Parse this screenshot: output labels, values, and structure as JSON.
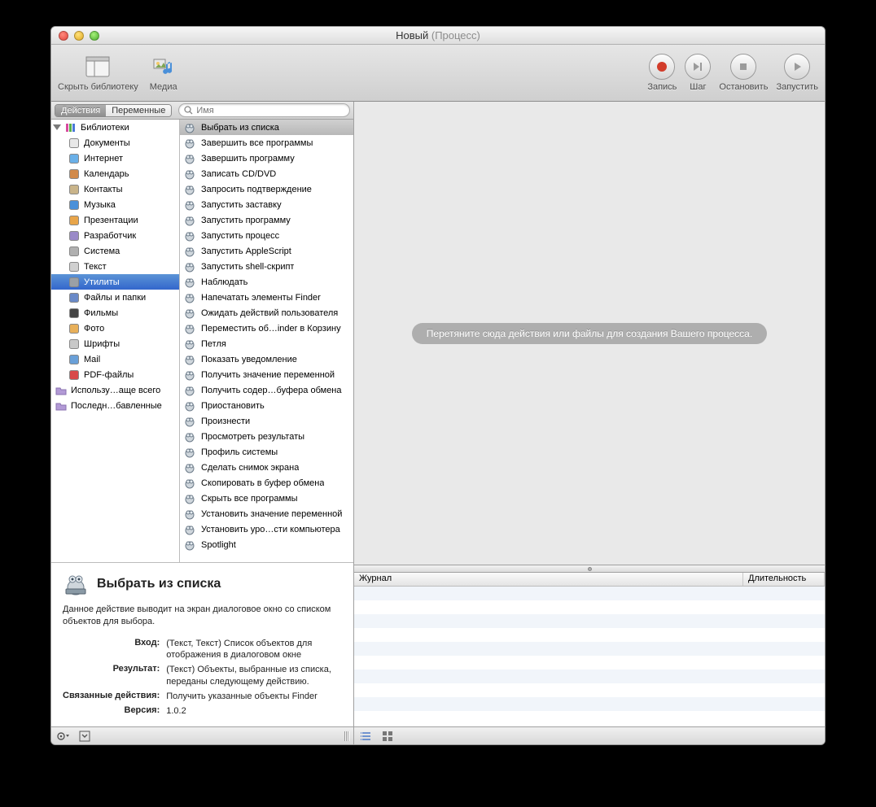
{
  "title": {
    "main": "Новый",
    "sub": "(Процесс)"
  },
  "toolbar": {
    "hide_library": "Скрыть библиотеку",
    "media": "Медиа",
    "record": "Запись",
    "step": "Шаг",
    "stop": "Остановить",
    "run": "Запустить"
  },
  "tabs": {
    "actions": "Действия",
    "variables": "Переменные"
  },
  "search": {
    "placeholder": "Имя"
  },
  "library": {
    "root": "Библиотеки",
    "items": [
      "Документы",
      "Интернет",
      "Календарь",
      "Контакты",
      "Музыка",
      "Презентации",
      "Разработчик",
      "Система",
      "Текст",
      "Утилиты",
      "Файлы и папки",
      "Фильмы",
      "Фото",
      "Шрифты",
      "Mail",
      "PDF-файлы"
    ],
    "selected_index": 9,
    "footer1": "Использу…аще всего",
    "footer2": "Последн…бавленные"
  },
  "actions": [
    "Выбрать из списка",
    "Завершить все программы",
    "Завершить программу",
    "Записать CD/DVD",
    "Запросить подтверждение",
    "Запустить заставку",
    "Запустить программу",
    "Запустить процесс",
    "Запустить AppleScript",
    "Запустить shell-скрипт",
    "Наблюдать",
    "Напечатать элементы Finder",
    "Ожидать действий пользователя",
    "Переместить об…inder в Корзину",
    "Петля",
    "Показать уведомление",
    "Получить значение переменной",
    "Получить содер…буфера обмена",
    "Приостановить",
    "Произнести",
    "Просмотреть результаты",
    "Профиль системы",
    "Сделать снимок экрана",
    "Скопировать в буфер обмена",
    "Скрыть все программы",
    "Установить значение переменной",
    "Установить уро…сти компьютера",
    "Spotlight"
  ],
  "canvas": {
    "placeholder": "Перетяните сюда действия или файлы для создания Вашего процесса."
  },
  "log": {
    "col1": "Журнал",
    "col2": "Длительность"
  },
  "info": {
    "title": "Выбрать из списка",
    "desc": "Данное действие выводит на экран диалоговое окно со списком объектов для выбора.",
    "input_label": "Вход:",
    "input_value": "(Текст, Текст) Список объектов для отображения в диалоговом окне",
    "result_label": "Результат:",
    "result_value": "(Текст) Объекты, выбранные из списка, переданы следующему действию.",
    "related_label": "Связанные действия:",
    "related_value": "Получить указанные объекты Finder",
    "version_label": "Версия:",
    "version_value": "1.0.2"
  }
}
